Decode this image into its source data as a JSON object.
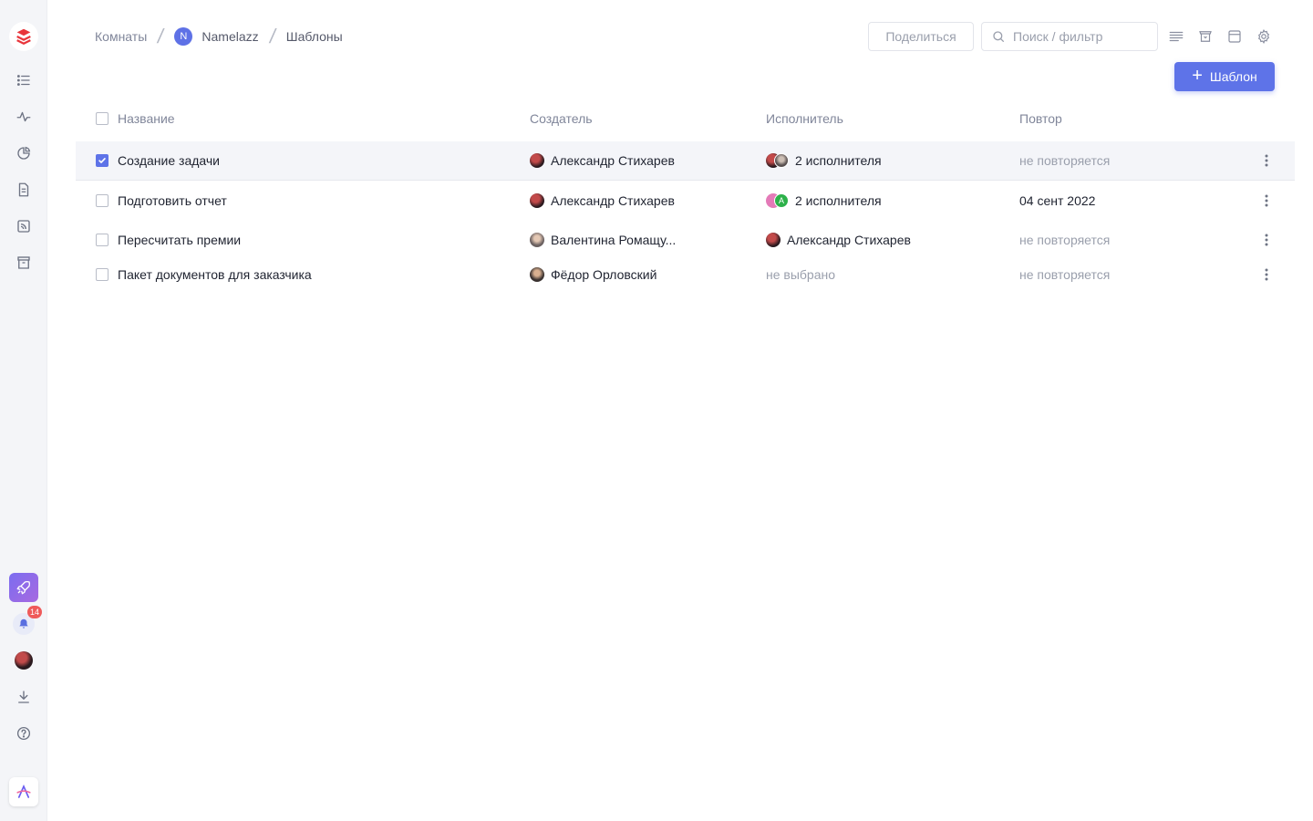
{
  "breadcrumb": {
    "rooms": "Комнаты",
    "room_initial": "N",
    "room": "Namelazz",
    "page": "Шаблоны"
  },
  "header": {
    "share_label": "Поделиться",
    "search_placeholder": "Поиск / фильтр",
    "add_label": "Шаблон"
  },
  "notifications": {
    "count": "14"
  },
  "table": {
    "columns": {
      "name": "Название",
      "creator": "Создатель",
      "assignee": "Исполнитель",
      "repeat": "Повтор"
    },
    "rows": [
      {
        "name": "Создание задачи",
        "creator": "Александр Стихарев",
        "assignee": "2 исполнителя",
        "repeat": "не повторяется",
        "checked": true
      },
      {
        "name": "Подготовить отчет",
        "creator": "Александр Стихарев",
        "assignee": "2 исполнителя",
        "assignee_initial": "A",
        "repeat": "04 сент 2022",
        "checked": false
      },
      {
        "name": "Пересчитать премии",
        "creator": "Валентина Ромащу...",
        "assignee": "Александр Стихарев",
        "repeat": "не повторяется",
        "checked": false
      },
      {
        "name": "Пакет документов для заказчика",
        "creator": "Фёдор Орловский",
        "assignee": "не выбрано",
        "repeat": "не повторяется",
        "checked": false
      }
    ]
  },
  "colors": {
    "accent": "#5e73e8",
    "badge": "#ef5a5a",
    "sidebar": "#f4f5f8"
  }
}
